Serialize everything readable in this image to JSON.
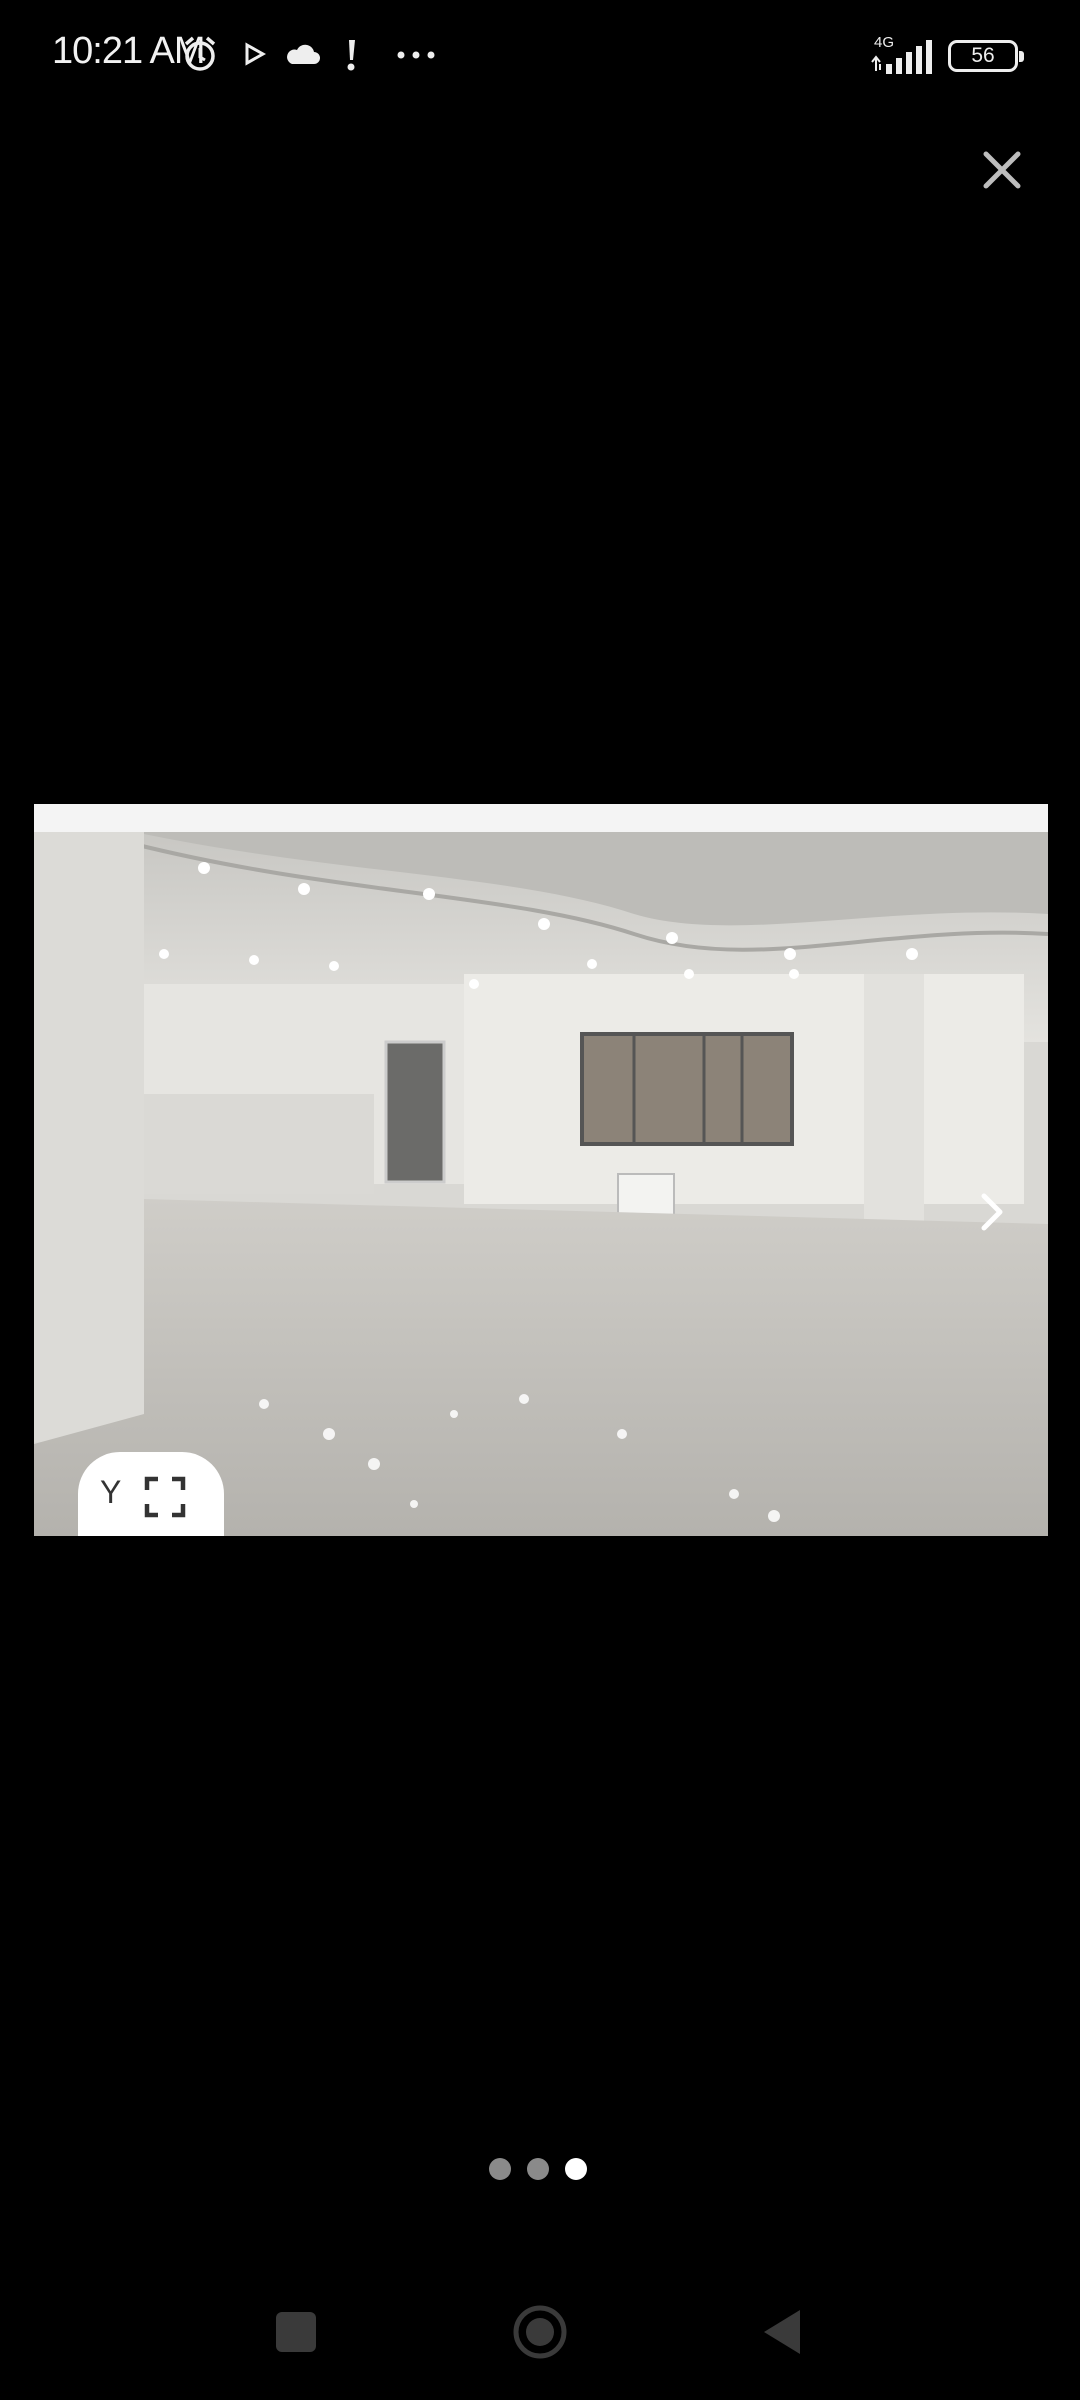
{
  "status_bar": {
    "time": "10:21 AM",
    "icons": [
      "alarm-icon",
      "play-icon",
      "cloud-icon",
      "alert-icon",
      "more-icon"
    ],
    "network": "4G",
    "battery": "56"
  },
  "viewer": {
    "close_icon": "close-icon",
    "photo_alt": "empty apartment interior",
    "next_icon": "chevron-right-icon",
    "photo_count_label": "Y",
    "fullscreen_icon": "fullscreen-icon"
  },
  "pager": {
    "total": 3,
    "active": 3
  },
  "nav_bar": {
    "icons": [
      "recents-icon",
      "home-icon",
      "back-icon"
    ]
  },
  "colors": {
    "background": "#000000",
    "dot_active": "#ffffff",
    "dot_inactive": "#8a8a8a"
  }
}
